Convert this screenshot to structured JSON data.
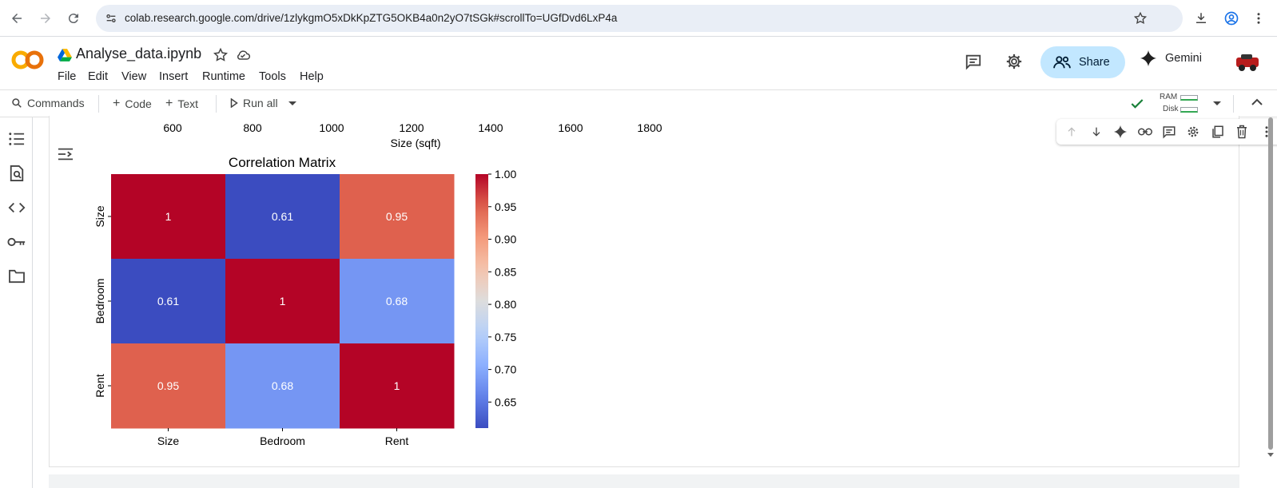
{
  "browser": {
    "url": "colab.research.google.com/drive/1zlykgmO5xDkKpZTG5OKB4a0n2yO7tSGk#scrollTo=UGfDvd6LxP4a"
  },
  "header": {
    "title": "Analyse_data.ipynb",
    "logo_text": "CO",
    "menu": [
      "File",
      "Edit",
      "View",
      "Insert",
      "Runtime",
      "Tools",
      "Help"
    ],
    "share_label": "Share",
    "gemini_label": "Gemini"
  },
  "toolbar": {
    "commands_label": "Commands",
    "code_label": "Code",
    "text_label": "Text",
    "run_all_label": "Run all",
    "ram_label": "RAM",
    "disk_label": "Disk"
  },
  "prev_plot": {
    "x_ticks": [
      "600",
      "800",
      "1000",
      "1200",
      "1400",
      "1600",
      "1800"
    ],
    "xlabel": "Size (sqft)"
  },
  "colors": {
    "share_bg": "#c2e7ff",
    "logo_orange": "#f9ab00",
    "logo_dark": "#e8710a",
    "check_green": "#188038"
  },
  "chart_data": {
    "type": "heatmap",
    "title": "Correlation Matrix",
    "row_labels": [
      "Size",
      "Bedroom",
      "Rent"
    ],
    "col_labels": [
      "Size",
      "Bedroom",
      "Rent"
    ],
    "values": [
      [
        1,
        0.61,
        0.95
      ],
      [
        0.61,
        1,
        0.68
      ],
      [
        0.95,
        0.68,
        1
      ]
    ],
    "annotations": [
      [
        "1",
        "0.61",
        "0.95"
      ],
      [
        "0.61",
        "1",
        "0.68"
      ],
      [
        "0.95",
        "0.68",
        "1"
      ]
    ],
    "colormap": "coolwarm",
    "vmin": 0.61,
    "vmax": 1.0,
    "colorbar_ticks": [
      "1.00",
      "0.95",
      "0.90",
      "0.85",
      "0.80",
      "0.75",
      "0.70",
      "0.65"
    ],
    "colorbar_tick_values": [
      1.0,
      0.95,
      0.9,
      0.85,
      0.8,
      0.75,
      0.7,
      0.65
    ]
  }
}
